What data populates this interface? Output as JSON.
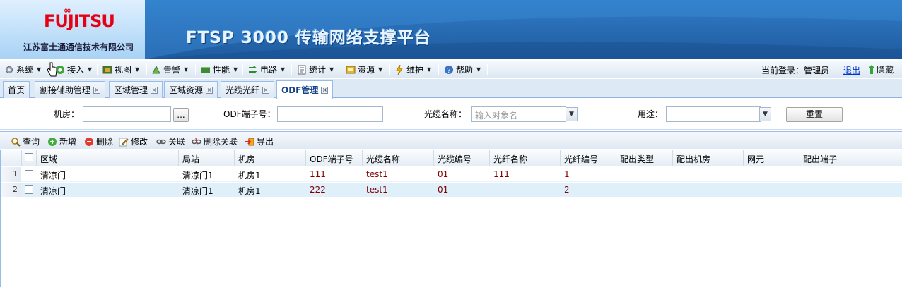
{
  "header": {
    "brand": "FUJITSU",
    "company": "江苏富士通通信技术有限公司",
    "platform_title": "FTSP 3000 传输网络支撑平台"
  },
  "menubar": {
    "items": [
      {
        "label": "系统",
        "icon": "gear-icon"
      },
      {
        "label": "接入",
        "icon": "access-icon"
      },
      {
        "label": "视图",
        "icon": "view-icon"
      },
      {
        "label": "告警",
        "icon": "alarm-icon"
      },
      {
        "label": "性能",
        "icon": "performance-icon"
      },
      {
        "label": "电路",
        "icon": "circuit-icon"
      },
      {
        "label": "统计",
        "icon": "statistics-icon"
      },
      {
        "label": "资源",
        "icon": "resource-icon"
      },
      {
        "label": "维护",
        "icon": "maintenance-icon"
      },
      {
        "label": "帮助",
        "icon": "help-icon"
      }
    ],
    "login_label": "当前登录：管理员",
    "logout_label": "退出",
    "hide_label": "隐藏"
  },
  "tabs": [
    {
      "label": "首页",
      "closable": false,
      "active": false
    },
    {
      "label": "割接辅助管理",
      "closable": true,
      "active": false
    },
    {
      "label": "区域管理",
      "closable": true,
      "active": false
    },
    {
      "label": "区域资源",
      "closable": true,
      "active": false
    },
    {
      "label": "光缆光纤",
      "closable": true,
      "active": false
    },
    {
      "label": "ODF管理",
      "closable": true,
      "active": true
    }
  ],
  "filter": {
    "room_label": "机房：",
    "room_value": "",
    "room_browse_label": "...",
    "odf_port_label": "ODF端子号：",
    "odf_port_value": "",
    "cable_name_label": "光缆名称：",
    "cable_name_placeholder": "输入对象名",
    "usage_label": "用途：",
    "usage_value": "",
    "reset_label": "重置"
  },
  "toolbar": {
    "query": "查询",
    "add": "新增",
    "delete": "删除",
    "edit": "修改",
    "link": "关联",
    "unlink": "删除关联",
    "export": "导出"
  },
  "grid": {
    "columns": [
      "区域",
      "局站",
      "机房",
      "ODF端子号",
      "光缆名称",
      "光缆编号",
      "光纤名称",
      "光纤编号",
      "配出类型",
      "配出机房",
      "网元",
      "配出端子"
    ],
    "rows": [
      {
        "no": "1",
        "cells": [
          "清凉门",
          "清凉门1",
          "机房1",
          "111",
          "test1",
          "01",
          "111",
          "1",
          "",
          "",
          "",
          ""
        ],
        "selected": false
      },
      {
        "no": "2",
        "cells": [
          "清凉门",
          "清凉门1",
          "机房1",
          "222",
          "test1",
          "01",
          "",
          "2",
          "",
          "",
          "",
          ""
        ],
        "selected": true
      }
    ]
  },
  "colors": {
    "banner_blue": "#2a6fb7",
    "brand_red": "#e60012",
    "selected_row": "#dff0fa",
    "link_blue": "#0033cc"
  }
}
